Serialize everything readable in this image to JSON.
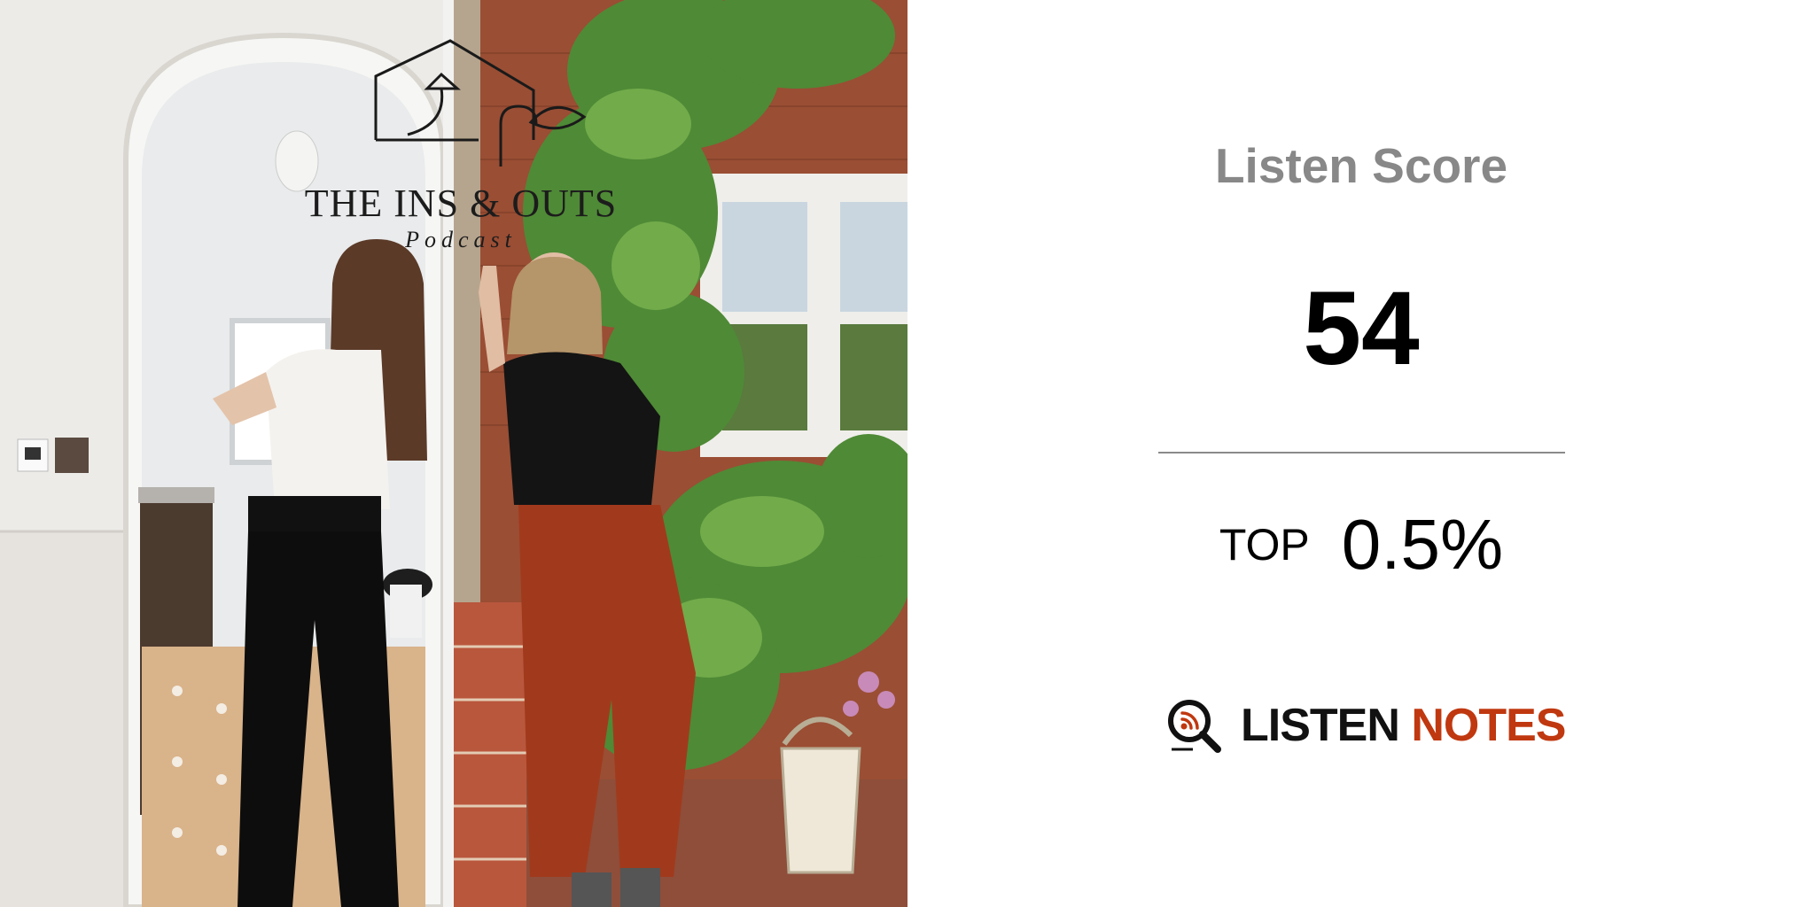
{
  "cover": {
    "logo_title": "THE INS & OUTS",
    "logo_subtitle": "Podcast",
    "icons": [
      "house-lamp-icon",
      "sprout-icon"
    ]
  },
  "score": {
    "label": "Listen Score",
    "value": "54",
    "rank_prefix": "TOP",
    "rank_percent": "0.5%"
  },
  "brand": {
    "word_1": "LISTEN",
    "word_2": "NOTES",
    "icon": "magnifier-podcast-icon",
    "colors": {
      "dark": "#111111",
      "accent": "#c0380f"
    }
  }
}
